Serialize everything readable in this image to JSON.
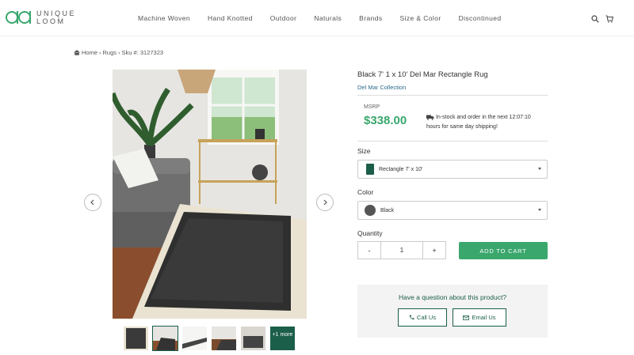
{
  "brand": {
    "logo_text_1": "UNIQUE",
    "logo_text_2": "LOOM",
    "accent": "#1b5e4a",
    "green": "#3aa76d"
  },
  "nav": [
    {
      "label": "Machine Woven"
    },
    {
      "label": "Hand Knotted"
    },
    {
      "label": "Outdoor"
    },
    {
      "label": "Naturals"
    },
    {
      "label": "Brands"
    },
    {
      "label": "Size & Color"
    },
    {
      "label": "Discontinued"
    }
  ],
  "header_icons": [
    "search-icon",
    "cart-icon"
  ],
  "breadcrumb": {
    "home": "Home",
    "sep1": "›",
    "category": "Rugs",
    "sep2": "›",
    "sku": "Sku #: 3127323"
  },
  "gallery": {
    "more_label": "+1 more",
    "thumbnail_count": 6,
    "active_index": 1
  },
  "product": {
    "title": "Black 7' 1 x 10' Del Mar Rectangle Rug",
    "collection": "Del Mar Collection",
    "msrp_label": "MSRP",
    "price": "$338.00",
    "stock_msg": "In-stock and order in the next 12:07:10 hours for same day shipping!"
  },
  "size": {
    "label": "Size",
    "selected": "Rectangle 7' x 10'"
  },
  "color": {
    "label": "Color",
    "selected": "Black"
  },
  "quantity": {
    "label": "Quantity",
    "minus": "-",
    "value": "1",
    "plus": "+"
  },
  "add_to_cart": "ADD TO CART",
  "question": {
    "text": "Have a question about this product?",
    "call": "Call Us",
    "email": "Email Us"
  }
}
